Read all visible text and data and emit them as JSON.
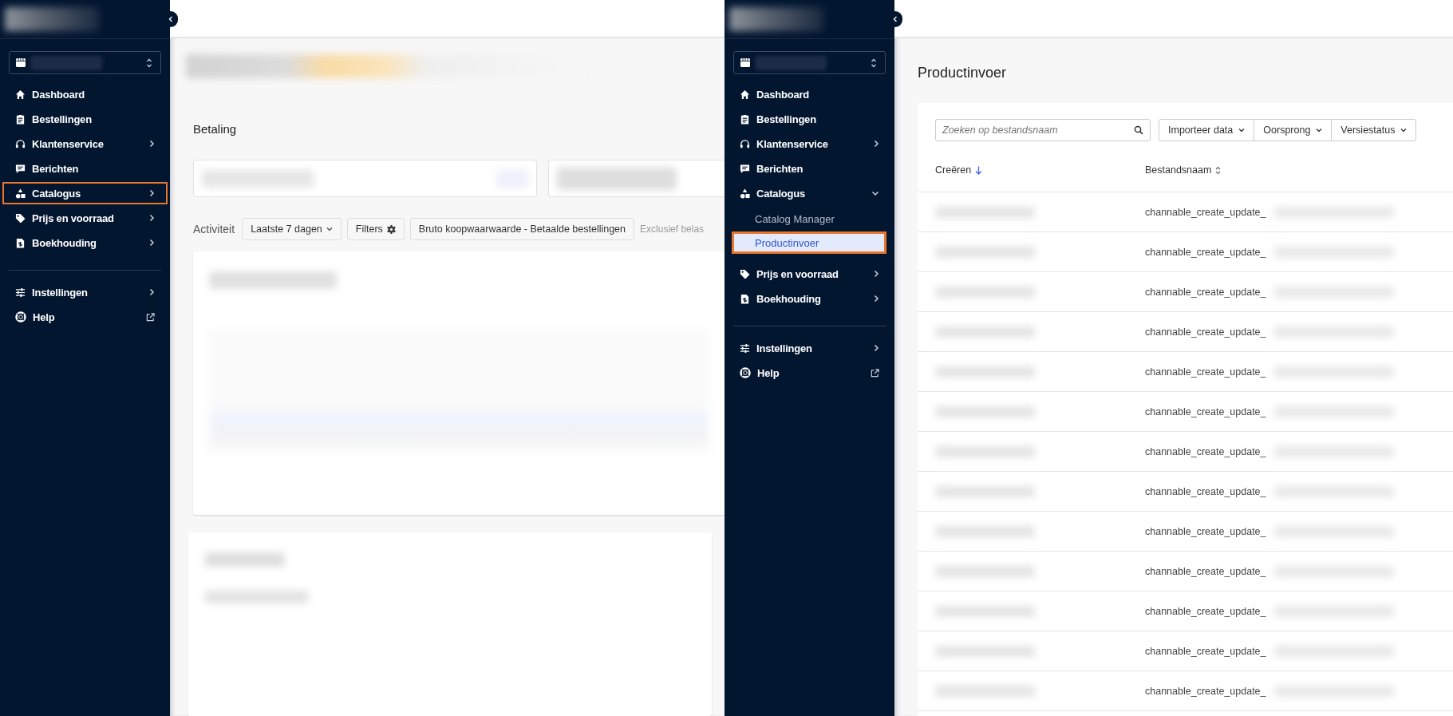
{
  "panels": [
    {
      "sidebar": {
        "items": [
          {
            "label": "Dashboard",
            "highlighted": false
          },
          {
            "label": "Bestellingen",
            "highlighted": false
          },
          {
            "label": "Klantenservice",
            "expanded": false,
            "highlighted": false
          },
          {
            "label": "Berichten",
            "highlighted": false
          },
          {
            "label": "Catalogus",
            "expanded": false,
            "highlighted": true
          },
          {
            "label": "Prijs en voorraad",
            "expanded": false,
            "highlighted": false
          },
          {
            "label": "Boekhouding",
            "expanded": false,
            "highlighted": false
          }
        ],
        "bottom_items": [
          {
            "label": "Instellingen",
            "expanded": false,
            "highlighted": false
          },
          {
            "label": "Help",
            "external": true,
            "highlighted": false
          }
        ]
      },
      "content": {
        "kind": "dashboard",
        "section_title": "Betaling",
        "activity": {
          "label": "Activiteit",
          "buttons": [
            {
              "label": "Laatste 7 dagen"
            },
            {
              "label": "Filters"
            },
            {
              "label": "Bruto koopwaarwaarde - Betaalde bestellingen"
            }
          ],
          "note": "Exclusief belas"
        }
      }
    },
    {
      "sidebar": {
        "items": [
          {
            "label": "Dashboard",
            "highlighted": false
          },
          {
            "label": "Bestellingen",
            "highlighted": false
          },
          {
            "label": "Klantenservice",
            "expanded": false,
            "highlighted": false
          },
          {
            "label": "Berichten",
            "highlighted": false
          },
          {
            "label": "Catalogus",
            "expanded": true,
            "highlighted": false,
            "children": [
              {
                "label": "Catalog Manager",
                "selected": false,
                "highlighted": false
              },
              {
                "label": "Productinvoer",
                "selected": true,
                "highlighted": true
              }
            ]
          },
          {
            "label": "Prijs en voorraad",
            "expanded": false,
            "highlighted": false
          },
          {
            "label": "Boekhouding",
            "expanded": false,
            "highlighted": false
          }
        ],
        "bottom_items": [
          {
            "label": "Instellingen",
            "expanded": false,
            "highlighted": false
          },
          {
            "label": "Help",
            "external": true,
            "highlighted": false
          }
        ]
      },
      "content": {
        "kind": "list",
        "title": "Productinvoer",
        "search": {
          "placeholder": "Zoeken op bestandsnaam"
        },
        "filters": [
          "Importeer data",
          "Oorsprong",
          "Versiestatus"
        ],
        "table": {
          "columns": [
            {
              "label": "Creëren",
              "sorted": true
            },
            {
              "label": "Bestandsnaam",
              "sorted": false
            }
          ],
          "rows": [
            {
              "column_2": "channable_create_update_"
            },
            {
              "column_2": "channable_create_update_"
            },
            {
              "column_2": "channable_create_update_"
            },
            {
              "column_2": "channable_create_update_"
            },
            {
              "column_2": "channable_create_update_"
            },
            {
              "column_2": "channable_create_update_"
            },
            {
              "column_2": "channable_create_update_"
            },
            {
              "column_2": "channable_create_update_"
            },
            {
              "column_2": "channable_create_update_"
            },
            {
              "column_2": "channable_create_update_"
            },
            {
              "column_2": "channable_create_update_"
            },
            {
              "column_2": "channable_create_update_"
            },
            {
              "column_2": "channable_create_update_"
            }
          ]
        }
      }
    }
  ]
}
